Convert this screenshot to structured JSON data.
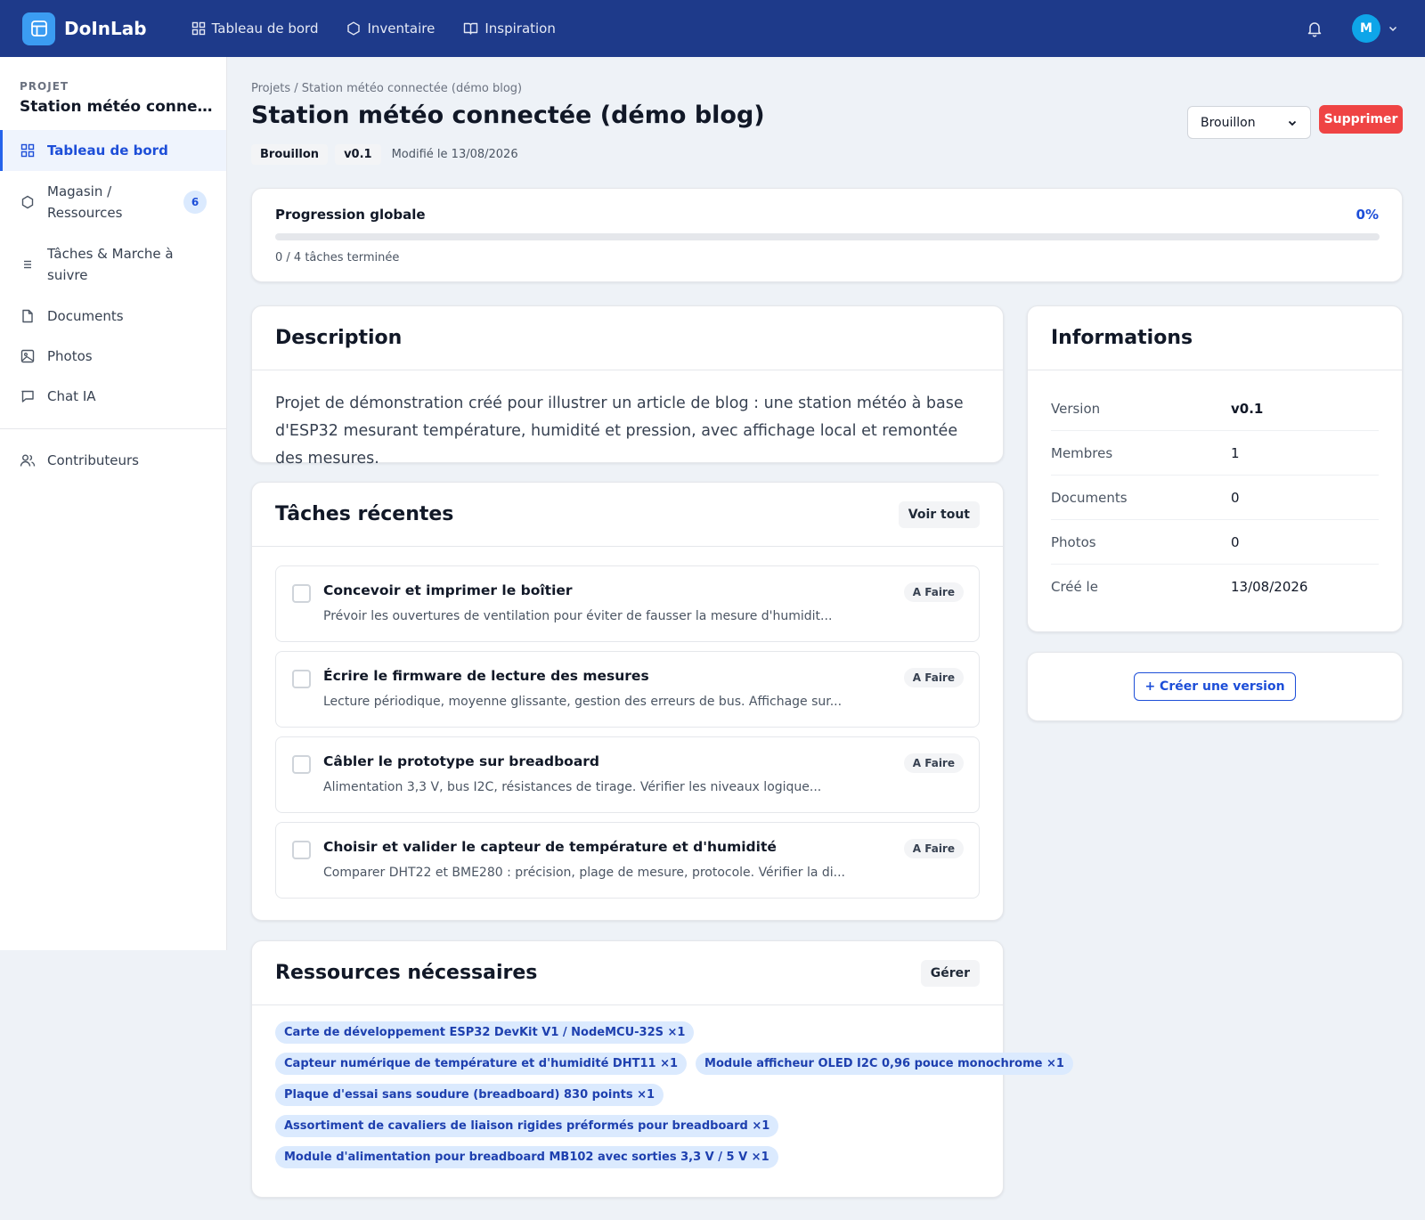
{
  "app": {
    "name": "DoInLab"
  },
  "topnav": {
    "items": [
      {
        "label": "Tableau de bord",
        "icon": "grid-icon"
      },
      {
        "label": "Inventaire",
        "icon": "hexagon-icon"
      },
      {
        "label": "Inspiration",
        "icon": "book-icon"
      }
    ],
    "avatar_initial": "M"
  },
  "sidebar": {
    "section_label": "PROJET",
    "project_name": "Station météo connectée (démo blog)",
    "items": [
      {
        "label": "Tableau de bord",
        "icon": "grid-icon",
        "active": true
      },
      {
        "label": "Magasin / Ressources",
        "icon": "hexagon-icon",
        "badge": "6"
      },
      {
        "label": "Tâches & Marche à suivre",
        "icon": "list-icon"
      },
      {
        "label": "Documents",
        "icon": "file-icon"
      },
      {
        "label": "Photos",
        "icon": "image-icon"
      },
      {
        "label": "Chat IA",
        "icon": "chat-icon"
      }
    ],
    "footer_item": {
      "label": "Contributeurs",
      "icon": "users-icon"
    }
  },
  "header": {
    "breadcrumb": "Projets / Station météo connectée (démo blog)",
    "title": "Station météo connectée (démo blog)",
    "status_tag": "Brouillon",
    "version_tag": "v0.1",
    "modified": "Modifié le 13/08/2026",
    "status_select": "Brouillon",
    "delete_label": "Supprimer"
  },
  "progress": {
    "title": "Progression globale",
    "percent_label": "0%",
    "fraction": 0,
    "subtitle": "0 / 4 tâches terminée"
  },
  "description": {
    "title": "Description",
    "text": "Projet de démonstration créé pour illustrer un article de blog : une station météo à base d'ESP32 mesurant température, humidité et pression, avec affichage local et remontée des mesures."
  },
  "tasks": {
    "title": "Tâches récentes",
    "view_all": "Voir tout",
    "items": [
      {
        "title": "Concevoir et imprimer le boîtier",
        "desc": "Prévoir les ouvertures de ventilation pour éviter de fausser la mesure d'humidit...",
        "status": "A Faire"
      },
      {
        "title": "Écrire le firmware de lecture des mesures",
        "desc": "Lecture périodique, moyenne glissante, gestion des erreurs de bus. Affichage sur...",
        "status": "A Faire"
      },
      {
        "title": "Câbler le prototype sur breadboard",
        "desc": "Alimentation 3,3 V, bus I2C, résistances de tirage. Vérifier les niveaux logique...",
        "status": "A Faire"
      },
      {
        "title": "Choisir et valider le capteur de température et d'humidité",
        "desc": "Comparer DHT22 et BME280 : précision, plage de mesure, protocole. Vérifier la di...",
        "status": "A Faire"
      }
    ]
  },
  "resources": {
    "title": "Ressources nécessaires",
    "manage": "Gérer",
    "items": [
      "Carte de développement ESP32 DevKit V1 / NodeMCU-32S ×1",
      "Capteur numérique de température et d'humidité DHT11 ×1",
      "Module afficheur OLED I2C 0,96 pouce monochrome ×1",
      "Plaque d'essai sans soudure (breadboard) 830 points ×1",
      "Assortiment de cavaliers de liaison rigides préformés pour breadboard ×1",
      "Module d'alimentation pour breadboard MB102 avec sorties 3,3 V / 5 V ×1"
    ]
  },
  "info": {
    "title": "Informations",
    "rows": [
      {
        "key": "Version",
        "value": "v0.1"
      },
      {
        "key": "Membres",
        "value": "1"
      },
      {
        "key": "Documents",
        "value": "0"
      },
      {
        "key": "Photos",
        "value": "0"
      },
      {
        "key": "Créé le",
        "value": "13/08/2026"
      }
    ]
  },
  "version_action": {
    "label": "+ Créer une version"
  },
  "colors": {
    "topbar": "#1e3a8a",
    "accent": "#2563eb",
    "danger": "#ef4444",
    "chip_bg": "#dbeafe"
  }
}
